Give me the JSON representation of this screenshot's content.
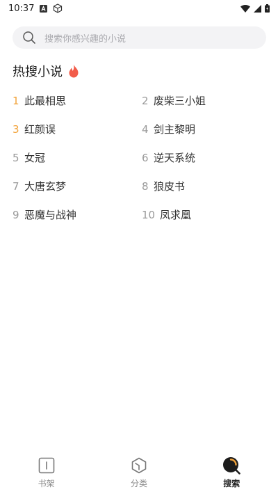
{
  "status_bar": {
    "time": "10:37",
    "icons": [
      "notification-a-icon",
      "cube-icon",
      "wifi-icon",
      "signal-icon",
      "battery-icon"
    ]
  },
  "search": {
    "placeholder": "搜索你感兴趣的小说"
  },
  "hot_section": {
    "title": "热搜小说",
    "icon": "fire-icon",
    "accent_color": "#f2a33a",
    "fire_color": "#f25c4a",
    "items": [
      {
        "rank": "1",
        "title": "此最相思"
      },
      {
        "rank": "2",
        "title": "废柴三小姐"
      },
      {
        "rank": "3",
        "title": "红颜误"
      },
      {
        "rank": "4",
        "title": "剑主黎明"
      },
      {
        "rank": "5",
        "title": "女冠"
      },
      {
        "rank": "6",
        "title": "逆天系统"
      },
      {
        "rank": "7",
        "title": "大唐玄梦"
      },
      {
        "rank": "8",
        "title": "狼皮书"
      },
      {
        "rank": "9",
        "title": "恶魔与战神"
      },
      {
        "rank": "10",
        "title": "凤求凰"
      }
    ]
  },
  "bottom_nav": {
    "items": [
      {
        "label": "书架",
        "icon": "bookshelf-icon",
        "active": false
      },
      {
        "label": "分类",
        "icon": "category-icon",
        "active": false
      },
      {
        "label": "搜索",
        "icon": "search-icon",
        "active": true
      }
    ]
  }
}
